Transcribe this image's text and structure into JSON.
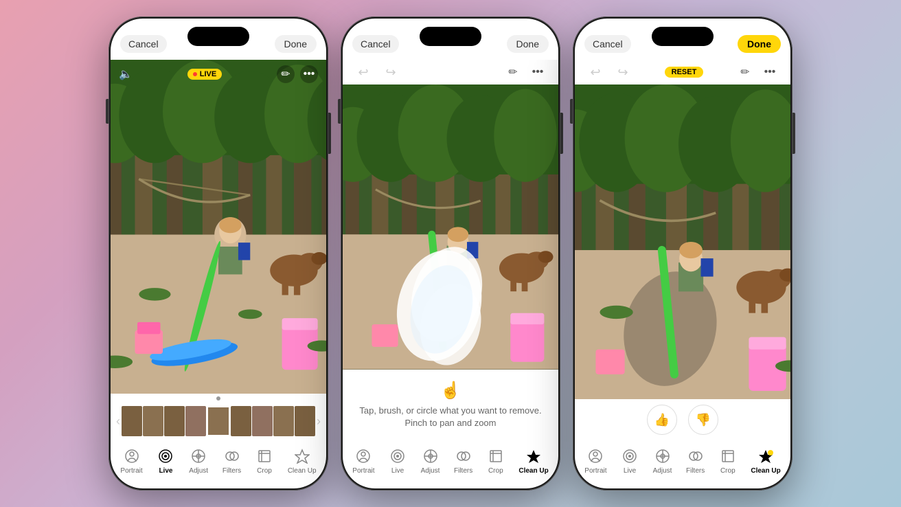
{
  "background": {
    "gradient": "linear-gradient(135deg, #e8a0b0, #d4a0c0, #c8b8d8, #b8c8d8, #a8c8d8)"
  },
  "phones": [
    {
      "id": "phone-1",
      "state": "live-view",
      "topBar": {
        "cancelLabel": "Cancel",
        "doneLabel": "Done",
        "doneStyle": "outline"
      },
      "photoControls": {
        "volumeIcon": "🔈",
        "liveBadge": "LIVE",
        "liveIcon": "●",
        "editIcon": "✏",
        "moreIcon": "···"
      },
      "toolbar": {
        "tools": [
          {
            "id": "portrait",
            "label": "Portrait",
            "icon": "◎",
            "active": false
          },
          {
            "id": "live",
            "label": "Live",
            "icon": "◉",
            "active": true
          },
          {
            "id": "adjust",
            "label": "Adjust",
            "icon": "⊕",
            "active": false
          },
          {
            "id": "filters",
            "label": "Filters",
            "icon": "◈",
            "active": false
          },
          {
            "id": "crop",
            "label": "Crop",
            "icon": "⊞",
            "active": false
          },
          {
            "id": "cleanup",
            "label": "Clean Up",
            "icon": "✦",
            "active": false
          }
        ]
      }
    },
    {
      "id": "phone-2",
      "state": "cleanup-brush",
      "topBar": {
        "cancelLabel": "Cancel",
        "doneLabel": "Done",
        "doneStyle": "outline"
      },
      "photoControls": {
        "undoIcon": "↩",
        "redoIcon": "↪",
        "editIcon": "✏",
        "moreIcon": "···"
      },
      "instructionText": "Tap, brush, or circle what you want to remove.\nPinch to pan and zoom",
      "instructionIcon": "👆",
      "toolbar": {
        "tools": [
          {
            "id": "portrait",
            "label": "Portrait",
            "icon": "◎",
            "active": false
          },
          {
            "id": "live",
            "label": "Live",
            "icon": "◉",
            "active": false
          },
          {
            "id": "adjust",
            "label": "Adjust",
            "icon": "⊕",
            "active": false
          },
          {
            "id": "filters",
            "label": "Filters",
            "icon": "◈",
            "active": false
          },
          {
            "id": "crop",
            "label": "Crop",
            "icon": "⊞",
            "active": false
          },
          {
            "id": "cleanup",
            "label": "Clean Up",
            "icon": "✦",
            "active": true
          }
        ]
      }
    },
    {
      "id": "phone-3",
      "state": "cleanup-done",
      "topBar": {
        "cancelLabel": "Cancel",
        "doneLabel": "Done",
        "doneStyle": "filled",
        "resetLabel": "RESET"
      },
      "photoControls": {
        "undoIcon": "↩",
        "redoIcon": "↪",
        "editIcon": "✏",
        "moreIcon": "···"
      },
      "feedbackButtons": {
        "thumbsUp": "👍",
        "thumbsDown": "👎"
      },
      "toolbar": {
        "tools": [
          {
            "id": "portrait",
            "label": "Portrait",
            "icon": "◎",
            "active": false
          },
          {
            "id": "live",
            "label": "Live",
            "icon": "◉",
            "active": false
          },
          {
            "id": "adjust",
            "label": "Adjust",
            "icon": "⊕",
            "active": false
          },
          {
            "id": "filters",
            "label": "Filters",
            "icon": "◈",
            "active": false
          },
          {
            "id": "crop",
            "label": "Crop",
            "icon": "⊞",
            "active": false
          },
          {
            "id": "cleanup",
            "label": "Clean Up",
            "icon": "✦",
            "active": true
          }
        ]
      }
    }
  ]
}
